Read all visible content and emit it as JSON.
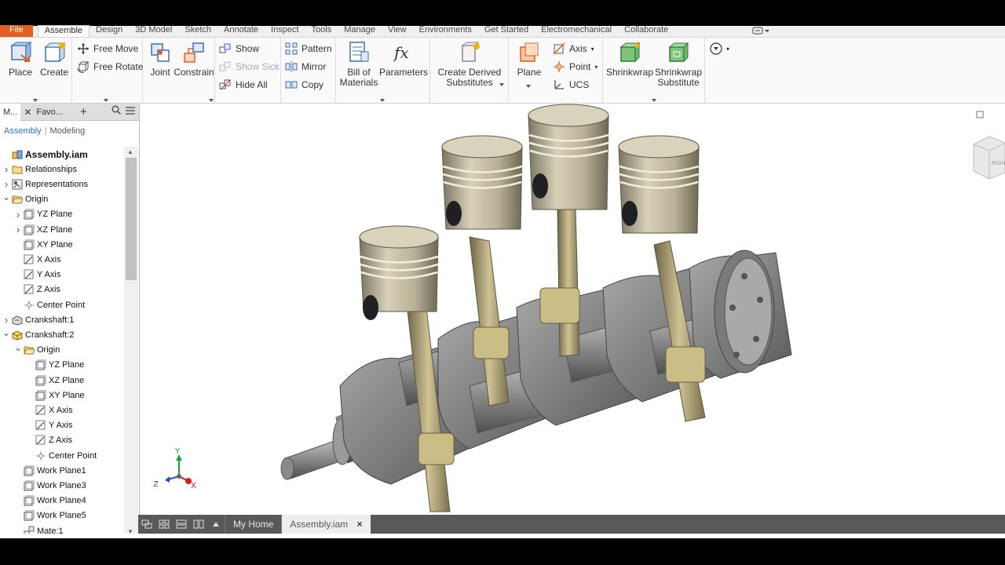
{
  "menu_tabs": [
    "File",
    "Assemble",
    "Design",
    "3D Model",
    "Sketch",
    "Annotate",
    "Inspect",
    "Tools",
    "Manage",
    "View",
    "Environments",
    "Get Started",
    "Electromechanical",
    "Collaborate"
  ],
  "ribbon": {
    "place": "Place",
    "create": "Create",
    "free_move": "Free Move",
    "free_rotate": "Free Rotate",
    "joint": "Joint",
    "constrain": "Constrain",
    "show": "Show",
    "show_sick": "Show Sick",
    "hide_all": "Hide All",
    "pattern": "Pattern",
    "mirror": "Mirror",
    "copy": "Copy",
    "bom_line1": "Bill of",
    "bom_line2": "Materials",
    "parameters": "Parameters",
    "derived_line1": "Create Derived",
    "derived_line2": "Substitutes",
    "plane": "Plane",
    "axis": "Axis",
    "point": "Point",
    "ucs": "UCS",
    "shrinkwrap": "Shrinkwrap",
    "shrinkwrap_sub_line1": "Shrinkwrap",
    "shrinkwrap_sub_line2": "Substitute"
  },
  "browser": {
    "tab_model": "M...",
    "tab_favorites": "Favo...",
    "mode_assembly": "Assembly",
    "mode_modeling": "Modeling",
    "nodes": [
      {
        "label": "Assembly.iam",
        "indent": 0,
        "icon": "assembly",
        "exp": "",
        "bold": true
      },
      {
        "label": "Relationships",
        "indent": 0,
        "icon": "folder",
        "exp": ">"
      },
      {
        "label": "Representations",
        "indent": 0,
        "icon": "reps",
        "exp": ">"
      },
      {
        "label": "Origin",
        "indent": 0,
        "icon": "folder-open",
        "exp": "v"
      },
      {
        "label": "YZ Plane",
        "indent": 1,
        "icon": "plane",
        "exp": ">"
      },
      {
        "label": "XZ Plane",
        "indent": 1,
        "icon": "plane",
        "exp": ">"
      },
      {
        "label": "XY Plane",
        "indent": 1,
        "icon": "plane",
        "exp": ""
      },
      {
        "label": "X Axis",
        "indent": 1,
        "icon": "axis",
        "exp": ""
      },
      {
        "label": "Y Axis",
        "indent": 1,
        "icon": "axis",
        "exp": ""
      },
      {
        "label": "Z Axis",
        "indent": 1,
        "icon": "axis",
        "exp": ""
      },
      {
        "label": "Center Point",
        "indent": 1,
        "icon": "point",
        "exp": ""
      },
      {
        "label": "Crankshaft:1",
        "indent": 0,
        "icon": "part-grey",
        "exp": ">"
      },
      {
        "label": "Crankshaft:2",
        "indent": 0,
        "icon": "part-yellow",
        "exp": "v"
      },
      {
        "label": "Origin",
        "indent": 1,
        "icon": "folder-open",
        "exp": "v"
      },
      {
        "label": "YZ Plane",
        "indent": 2,
        "icon": "plane",
        "exp": ""
      },
      {
        "label": "XZ Plane",
        "indent": 2,
        "icon": "plane",
        "exp": ""
      },
      {
        "label": "XY Plane",
        "indent": 2,
        "icon": "plane",
        "exp": ""
      },
      {
        "label": "X Axis",
        "indent": 2,
        "icon": "axis",
        "exp": ""
      },
      {
        "label": "Y Axis",
        "indent": 2,
        "icon": "axis",
        "exp": ""
      },
      {
        "label": "Z Axis",
        "indent": 2,
        "icon": "axis",
        "exp": ""
      },
      {
        "label": "Center Point",
        "indent": 2,
        "icon": "point",
        "exp": ""
      },
      {
        "label": "Work Plane1",
        "indent": 1,
        "icon": "plane",
        "exp": ""
      },
      {
        "label": "Work Plane3",
        "indent": 1,
        "icon": "plane",
        "exp": ""
      },
      {
        "label": "Work Plane4",
        "indent": 1,
        "icon": "plane",
        "exp": ""
      },
      {
        "label": "Work Plane5",
        "indent": 1,
        "icon": "plane",
        "exp": ""
      },
      {
        "label": "Mate:1",
        "indent": 1,
        "icon": "mate",
        "exp": ""
      }
    ]
  },
  "viewport": {
    "triad": {
      "x": "X",
      "y": "Y",
      "z": "Z"
    },
    "viewcube_label": "RIGHT"
  },
  "doc_tabs": {
    "home": "My Home",
    "active": "Assembly.iam",
    "close": "×"
  },
  "colors": {
    "file_tab": "#e2601f",
    "link": "#2a6ebb",
    "doc_bar": "#595959",
    "axis_x": "#d11f1f",
    "axis_y": "#1aa33a",
    "axis_z": "#1f4fd1"
  }
}
